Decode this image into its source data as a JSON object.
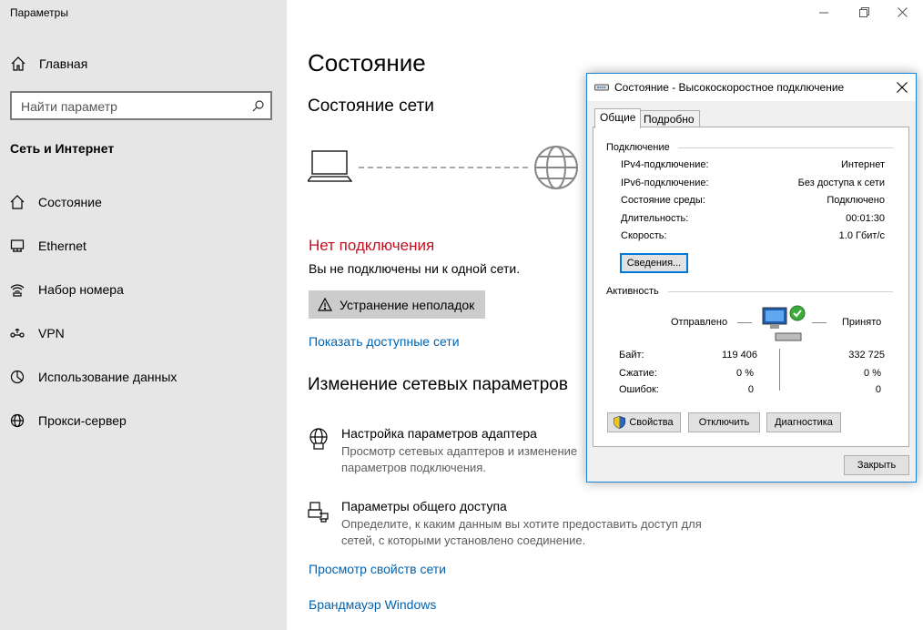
{
  "sidebar": {
    "app_title": "Параметры",
    "home_label": "Главная",
    "search_placeholder": "Найти параметр",
    "section_title": "Сеть и Интернет",
    "items": [
      {
        "label": "Состояние",
        "icon": "home-status-icon"
      },
      {
        "label": "Ethernet",
        "icon": "ethernet-icon"
      },
      {
        "label": "Набор номера",
        "icon": "dialup-icon"
      },
      {
        "label": "VPN",
        "icon": "vpn-icon"
      },
      {
        "label": "Использование данных",
        "icon": "data-usage-icon"
      },
      {
        "label": "Прокси-сервер",
        "icon": "globe-icon"
      }
    ]
  },
  "main": {
    "title": "Состояние",
    "network_status_title": "Состояние сети",
    "no_connection": "Нет подключения",
    "no_connection_sub": "Вы не подключены ни к одной сети.",
    "troubleshoot_label": "Устранение неполадок",
    "show_networks_link": "Показать доступные сети",
    "change_settings_title": "Изменение сетевых параметров",
    "adapter_title": "Настройка параметров адаптера",
    "adapter_desc": "Просмотр сетевых адаптеров и изменение параметров подключения.",
    "sharing_title": "Параметры общего доступа",
    "sharing_desc": "Определите, к каким данным вы хотите предоставить доступ для сетей, с которыми установлено соединение.",
    "view_props_link": "Просмотр свойств сети",
    "firewall_link": "Брандмауэр Windows"
  },
  "dialog": {
    "title": "Состояние - Высокоскоростное подключение",
    "tabs": [
      "Общие",
      "Подробно"
    ],
    "connection_group": "Подключение",
    "rows": [
      {
        "k": "IPv4-подключение:",
        "v": "Интернет"
      },
      {
        "k": "IPv6-подключение:",
        "v": "Без доступа к сети"
      },
      {
        "k": "Состояние среды:",
        "v": "Подключено"
      },
      {
        "k": "Длительность:",
        "v": "00:01:30"
      },
      {
        "k": "Скорость:",
        "v": "1.0 Гбит/с"
      }
    ],
    "details_button": "Сведения...",
    "activity_group": "Активность",
    "sent_label": "Отправлено",
    "received_label": "Принято",
    "bytes_label": "Байт:",
    "bytes_sent": "119 406",
    "bytes_received": "332 725",
    "compression_label": "Сжатие:",
    "compression_sent": "0 %",
    "compression_received": "0 %",
    "errors_label": "Ошибок:",
    "errors_sent": "0",
    "errors_received": "0",
    "properties_button": "Свойства",
    "disable_button": "Отключить",
    "diagnose_button": "Диагностика",
    "close_button": "Закрыть"
  }
}
